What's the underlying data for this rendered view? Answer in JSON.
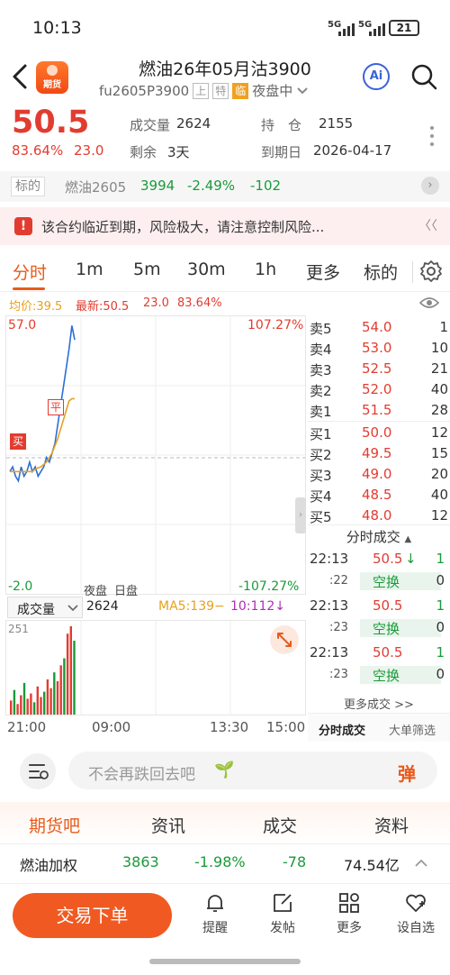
{
  "status_bar": {
    "time": "10:13",
    "sig1": "5G",
    "sig2": "5G",
    "battery": "21"
  },
  "header": {
    "title": "燃油26年05月沽3900",
    "code": "fu2605P3900",
    "exchange_tag": "上",
    "special_tag": "特",
    "expiry_tag": "临",
    "session": "夜盘中",
    "logo_text": "期货",
    "ai_label": "Ai"
  },
  "quote": {
    "price": "50.5",
    "change_pct": "83.64%",
    "change_abs": "23.0",
    "volume_label": "成交量",
    "volume": "2624",
    "remaining_label": "剩余",
    "remaining": "3天",
    "oi_label": "持　仓",
    "oi": "2155",
    "expiry_label": "到期日",
    "expiry": "2026-04-17"
  },
  "underlying": {
    "label": "标的",
    "name": "燃油2605",
    "price": "3994",
    "pct": "-2.49%",
    "chg": "-102"
  },
  "warning": {
    "text": "该合约临近到期，风险极大，请注意控制风险...",
    "more": "〈〈"
  },
  "period_tabs": [
    "分时",
    "1m",
    "5m",
    "30m",
    "1h",
    "更多",
    "标的"
  ],
  "info_line": {
    "avg": "均价:39.5",
    "latest": "最新:50.5",
    "chg": "23.0",
    "pct": "83.64%"
  },
  "chart": {
    "y_top": "57.0",
    "y_bottom": "-2.0",
    "pct_top": "107.27%",
    "pct_bottom": "-107.27%",
    "buy_marker": "买",
    "close_marker": "平",
    "session_night": "夜盘",
    "session_day": "日盘"
  },
  "chart_data": {
    "type": "line",
    "ylim": [
      -2.0,
      57.0
    ],
    "series": [
      {
        "values": [
          24,
          25,
          23,
          22,
          25,
          23,
          24,
          26,
          24,
          25,
          23,
          24,
          25,
          27,
          26,
          28,
          30,
          34,
          38,
          42,
          46,
          50,
          55,
          52
        ]
      },
      {
        "values": [
          24,
          24,
          24,
          24,
          24,
          24,
          24,
          24,
          24,
          24.5,
          24.8,
          25,
          25.5,
          26,
          27,
          28,
          29.5,
          31,
          33,
          35,
          37,
          39,
          39.5,
          39.5
        ]
      }
    ]
  },
  "order_book": {
    "asks": [
      {
        "label": "卖5",
        "price": "54.0",
        "qty": "1"
      },
      {
        "label": "卖4",
        "price": "53.0",
        "qty": "10"
      },
      {
        "label": "卖3",
        "price": "52.5",
        "qty": "21"
      },
      {
        "label": "卖2",
        "price": "52.0",
        "qty": "40"
      },
      {
        "label": "卖1",
        "price": "51.5",
        "qty": "28"
      }
    ],
    "bids": [
      {
        "label": "买1",
        "price": "50.0",
        "qty": "12"
      },
      {
        "label": "买2",
        "price": "49.5",
        "qty": "15"
      },
      {
        "label": "买3",
        "price": "49.0",
        "qty": "20"
      },
      {
        "label": "买4",
        "price": "48.5",
        "qty": "40"
      },
      {
        "label": "买5",
        "price": "48.0",
        "qty": "12"
      }
    ]
  },
  "ticks": {
    "title": "分时成交",
    "rows": [
      {
        "time": "22:13",
        "sec": ":22",
        "price": "50.5",
        "dir": "↓",
        "qty": "1",
        "type": "空换",
        "type_qty": "0"
      },
      {
        "time": "22:13",
        "sec": ":23",
        "price": "50.5",
        "dir": "",
        "qty": "1",
        "type": "空换",
        "type_qty": "0"
      },
      {
        "time": "22:13",
        "sec": ":23",
        "price": "50.5",
        "dir": "",
        "qty": "1",
        "type": "空换",
        "type_qty": "0"
      }
    ],
    "more": "更多成交 >>",
    "tab_active": "分时成交",
    "tab_other": "大单筛选"
  },
  "volume": {
    "selector": "成交量",
    "value": "2624",
    "ma5": "MA5:139−",
    "ma10": "10:112↓",
    "max_label": "251",
    "bars": [
      40,
      70,
      30,
      55,
      90,
      45,
      60,
      35,
      80,
      50,
      65,
      100,
      75,
      120,
      95,
      140,
      160,
      230,
      251,
      210
    ]
  },
  "time_axis": [
    "21:00",
    "09:00",
    "13:30",
    "15:00"
  ],
  "comment": {
    "placeholder": "不会再跌回去吧",
    "danmu": "弹"
  },
  "bottom_tabs": [
    "期货吧",
    "资讯",
    "成交",
    "资料"
  ],
  "index_row": {
    "name": "燃油加权",
    "price": "3863",
    "pct": "-1.98%",
    "chg": "-78",
    "amount": "74.54亿"
  },
  "bottom_bar": {
    "trade": "交易下单",
    "items": [
      "提醒",
      "发帖",
      "更多",
      "设自选"
    ]
  },
  "colors": {
    "up": "#e23c30",
    "down": "#1a9a3a",
    "accent": "#f05a22",
    "avg_line": "#e8a020",
    "price_line": "#2a6fd6"
  }
}
